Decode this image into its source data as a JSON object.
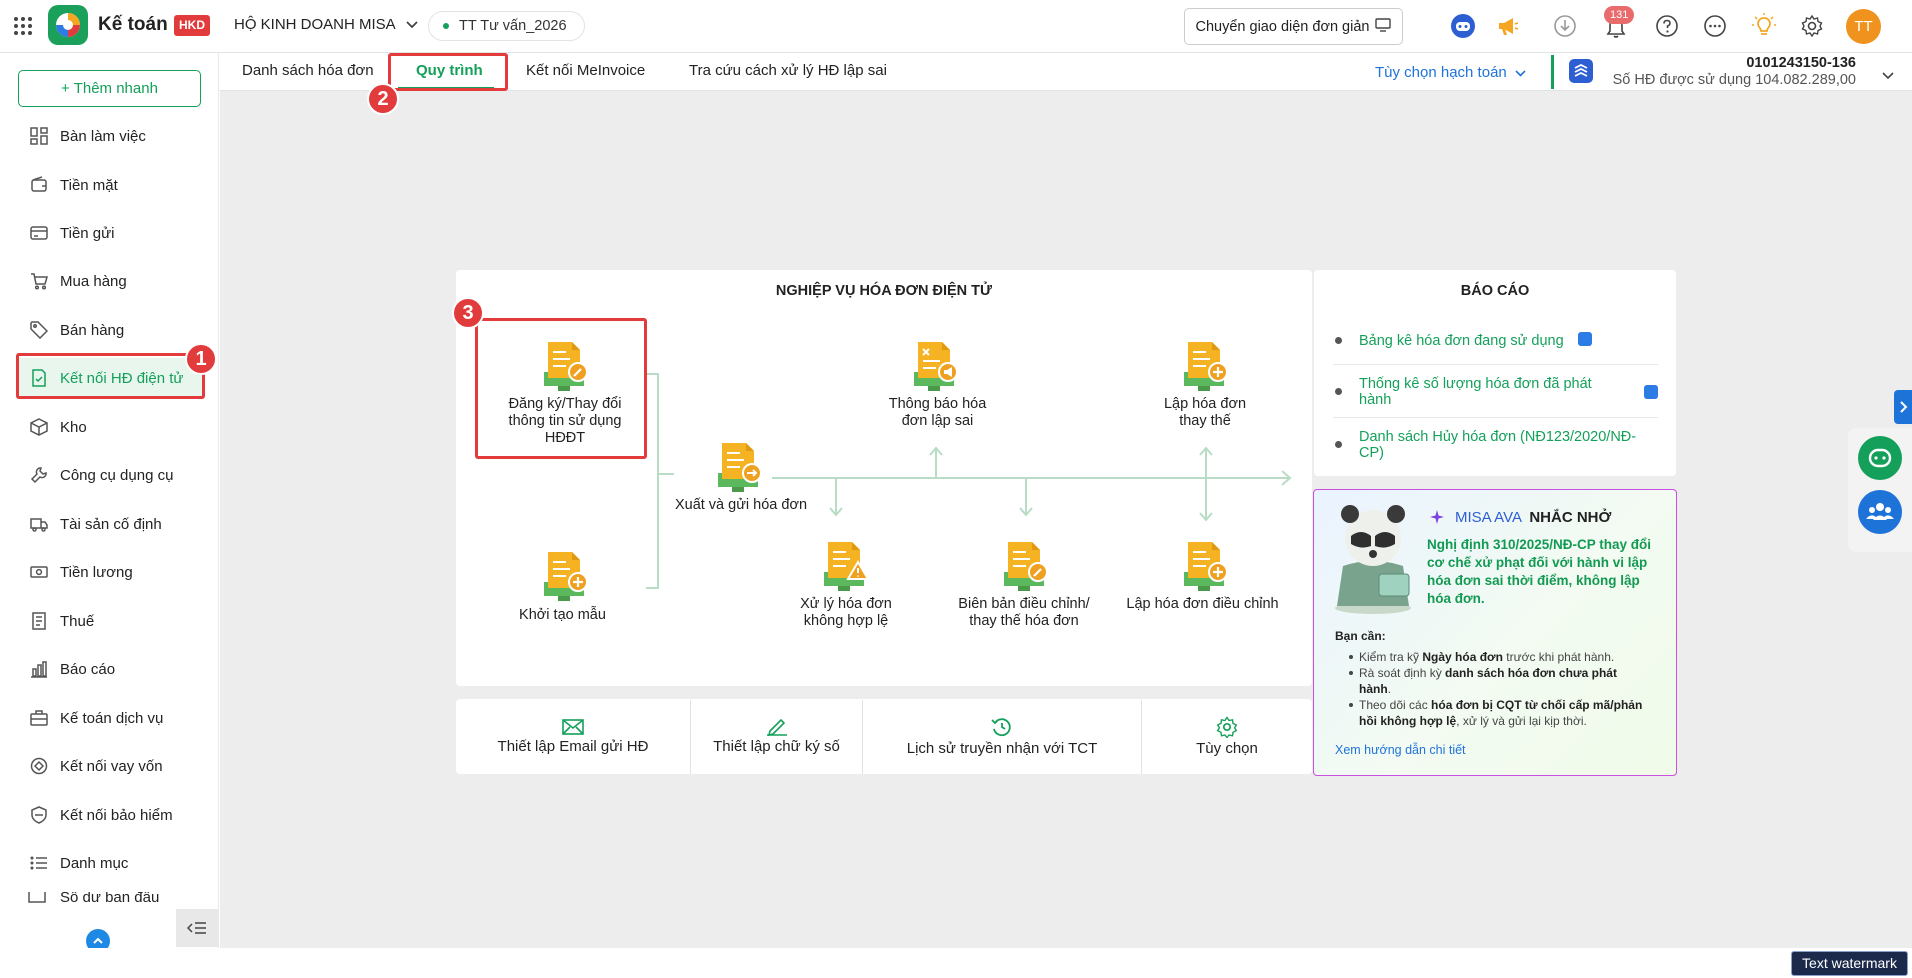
{
  "app": {
    "name": "Kế toán",
    "badge": "HKD",
    "company": "HỘ KINH DOANH MISA",
    "period": "TT Tư vấn_2026"
  },
  "header": {
    "switch_ui_label": "Chuyển giao diện đơn giản",
    "notification_count": "131",
    "user_initials": "TT"
  },
  "sidebar": {
    "quick_add_label": "+ Thêm nhanh",
    "items": [
      {
        "label": "Bàn làm việc",
        "icon": "dashboard-icon"
      },
      {
        "label": "Tiền mặt",
        "icon": "wallet-icon"
      },
      {
        "label": "Tiền gửi",
        "icon": "card-icon"
      },
      {
        "label": "Mua hàng",
        "icon": "cart-icon"
      },
      {
        "label": "Bán hàng",
        "icon": "tag-icon"
      },
      {
        "label": "Kết nối HĐ điện tử",
        "icon": "invoice-icon"
      },
      {
        "label": "Kho",
        "icon": "box-icon"
      },
      {
        "label": "Công cụ dụng cụ",
        "icon": "tools-icon"
      },
      {
        "label": "Tài sản cố định",
        "icon": "truck-icon"
      },
      {
        "label": "Tiền lương",
        "icon": "salary-icon"
      },
      {
        "label": "Thuế",
        "icon": "tax-icon"
      },
      {
        "label": "Báo cáo",
        "icon": "chart-icon"
      },
      {
        "label": "Kế toán dịch vụ",
        "icon": "briefcase-icon"
      },
      {
        "label": "Kết nối vay vốn",
        "icon": "loan-icon"
      },
      {
        "label": "Kết nối bảo hiểm",
        "icon": "shield-icon"
      },
      {
        "label": "Danh mục",
        "icon": "list-icon"
      },
      {
        "label": "Số dư ban đầu",
        "icon": "balance-icon"
      }
    ]
  },
  "tabs": [
    {
      "label": "Danh sách hóa đơn"
    },
    {
      "label": "Quy trình"
    },
    {
      "label": "Kết nối MeInvoice"
    },
    {
      "label": "Tra cứu cách xử lý HĐ lập sai"
    }
  ],
  "options_label": "Tùy chọn hạch toán",
  "account": {
    "tax_code": "0101243150-136",
    "usage": "Số HĐ được sử dụng 104.082.289,00"
  },
  "markers": {
    "m1": "1",
    "m2": "2",
    "m3": "3"
  },
  "flow": {
    "title": "NGHIỆP VỤ HÓA ĐƠN ĐIỆN TỬ",
    "register": "Đăng ký/Thay đổi thông tin sử dụng HĐĐT",
    "template": "Khởi tạo mẫu",
    "issue": "Xuất và gửi hóa đơn",
    "notify_wrong": "Thông báo hóa đơn lập sai",
    "replace": "Lập hóa đơn thay thế",
    "invalid": "Xử lý hóa đơn không hợp lệ",
    "minutes": "Biên bản điều chỉnh/ thay thế hóa đơn",
    "adjust": "Lập hóa đơn điều chỉnh"
  },
  "bottom": [
    {
      "label": "Thiết lập Email gửi HĐ",
      "icon": "email-icon"
    },
    {
      "label": "Thiết lập chữ ký số",
      "icon": "signature-icon"
    },
    {
      "label": "Lịch sử truyền nhận với TCT",
      "icon": "history-icon"
    },
    {
      "label": "Tùy chọn",
      "icon": "settings-icon"
    }
  ],
  "reports": {
    "title": "BÁO CÁO",
    "items": [
      {
        "label": "Bảng kê hóa đơn đang sử dụng"
      },
      {
        "label": "Thống kê số lượng hóa đơn đã phát hành"
      },
      {
        "label": "Danh sách Hủy hóa đơn (NĐ123/2020/NĐ-CP)"
      }
    ]
  },
  "ava": {
    "brand": "MISA AVA",
    "title": "NHẮC NHỞ",
    "message": "Nghị định 310/2025/NĐ-CP thay đổi cơ chế xử phạt đối với hành vi lập hóa đơn sai thời điểm, không lập hóa đơn.",
    "need": "Bạn cần:",
    "b1_pre": "Kiểm tra kỹ ",
    "b1_bold": "Ngày hóa đơn",
    "b1_post": " trước khi phát hành.",
    "b2_pre": "Rà soát định kỳ ",
    "b2_bold": "danh sách hóa đơn chưa phát hành",
    "b2_post": ".",
    "b3_pre": "Theo dõi các ",
    "b3_bold": "hóa đơn bị CQT từ chối cấp mã/phản hồi không hợp lệ",
    "b3_post": ", xử lý và gửi lại kịp thời.",
    "link": "Xem hướng dẫn chi tiết"
  },
  "watermark": "Text watermark",
  "colors": {
    "accent_green": "#14a05a",
    "marker_red": "#e23b3b",
    "link_blue": "#1e73d9"
  }
}
